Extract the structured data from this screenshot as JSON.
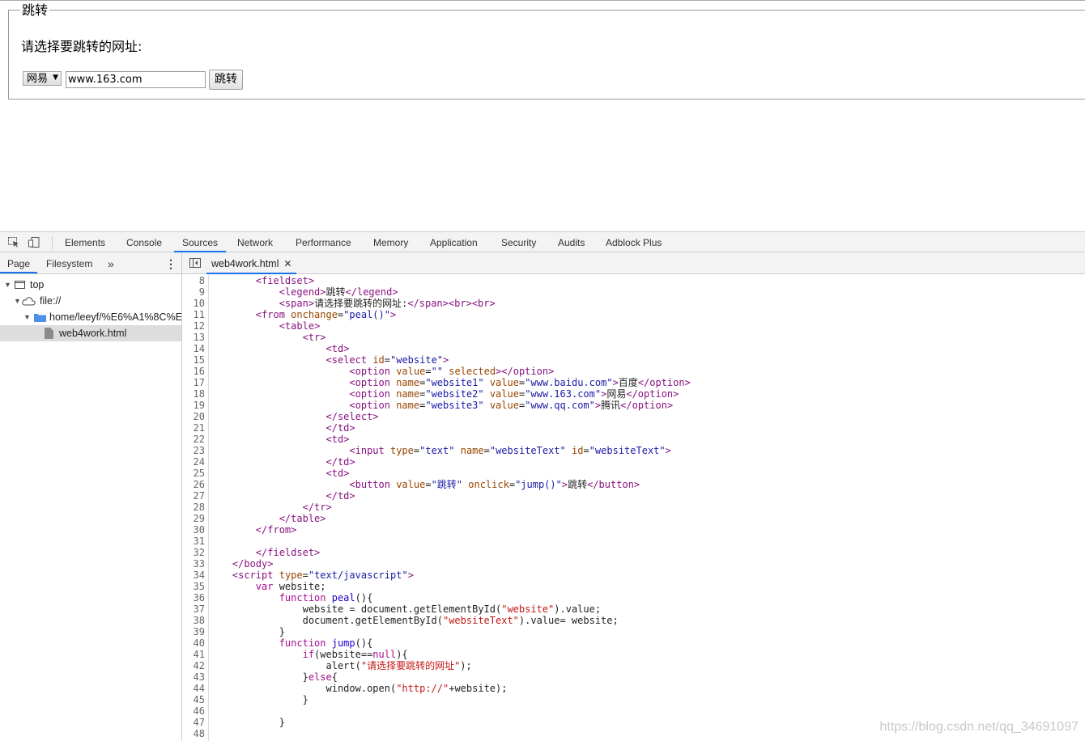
{
  "page": {
    "legend": "跳转",
    "prompt": "请选择要跳转的网址:",
    "select_value": "网易",
    "text_value": "www.163.com",
    "button_label": "跳转"
  },
  "devtools": {
    "tabs": [
      "Elements",
      "Console",
      "Sources",
      "Network",
      "Performance",
      "Memory",
      "Application",
      "Security",
      "Audits",
      "Adblock Plus"
    ],
    "active_tab": "Sources",
    "navigator_tabs": [
      "Page",
      "Filesystem"
    ],
    "tree": {
      "top": "top",
      "file": "file://",
      "folder": "home/leeyf/%E6%A1%8C%E",
      "file_item": "web4work.html"
    },
    "editor_tab": "web4work.html",
    "line_numbers": [
      "8",
      "9",
      "10",
      "11",
      "12",
      "13",
      "14",
      "15",
      "16",
      "17",
      "18",
      "19",
      "20",
      "21",
      "22",
      "23",
      "24",
      "25",
      "26",
      "27",
      "28",
      "29",
      "30",
      "31",
      "32",
      "33",
      "34",
      "35",
      "36",
      "37",
      "38",
      "39",
      "40",
      "41",
      "42",
      "43",
      "44",
      "45",
      "46",
      "47",
      "48"
    ],
    "code_lines": [
      "        <fieldset>",
      "            <legend>跳转</legend>",
      "            <span>请选择要跳转的网址:</span><br><br>",
      "        <from onchange=\"peal()\">",
      "            <table>",
      "                <tr>",
      "                    <td>",
      "                    <select id=\"website\">",
      "                        <option value=\"\" selected></option>",
      "                        <option name=\"website1\" value=\"www.baidu.com\">百度</option>",
      "                        <option name=\"website2\" value=\"www.163.com\">网易</option>",
      "                        <option name=\"website3\" value=\"www.qq.com\">腾讯</option>",
      "                    </select>",
      "                    </td>",
      "                    <td>",
      "                        <input type=\"text\" name=\"websiteText\" id=\"websiteText\">",
      "                    </td>",
      "                    <td>",
      "                        <button value=\"跳转\" onclick=\"jump()\">跳转</button>",
      "                    </td>",
      "                </tr>",
      "            </table>",
      "        </from>",
      "",
      "        </fieldset>",
      "    </body>",
      "    <script type=\"text/javascript\">",
      "        var website;",
      "            function peal(){",
      "                website = document.getElementById(\"website\").value;",
      "                document.getElementById(\"websiteText\").value= website;",
      "            }",
      "            function jump(){",
      "                if(website==null){",
      "                    alert(\"请选择要跳转的网址\");",
      "                }else{",
      "                    window.open(\"http://\"+website);",
      "                }",
      "",
      "            }",
      ""
    ]
  },
  "watermark": "https://blog.csdn.net/qq_34691097"
}
